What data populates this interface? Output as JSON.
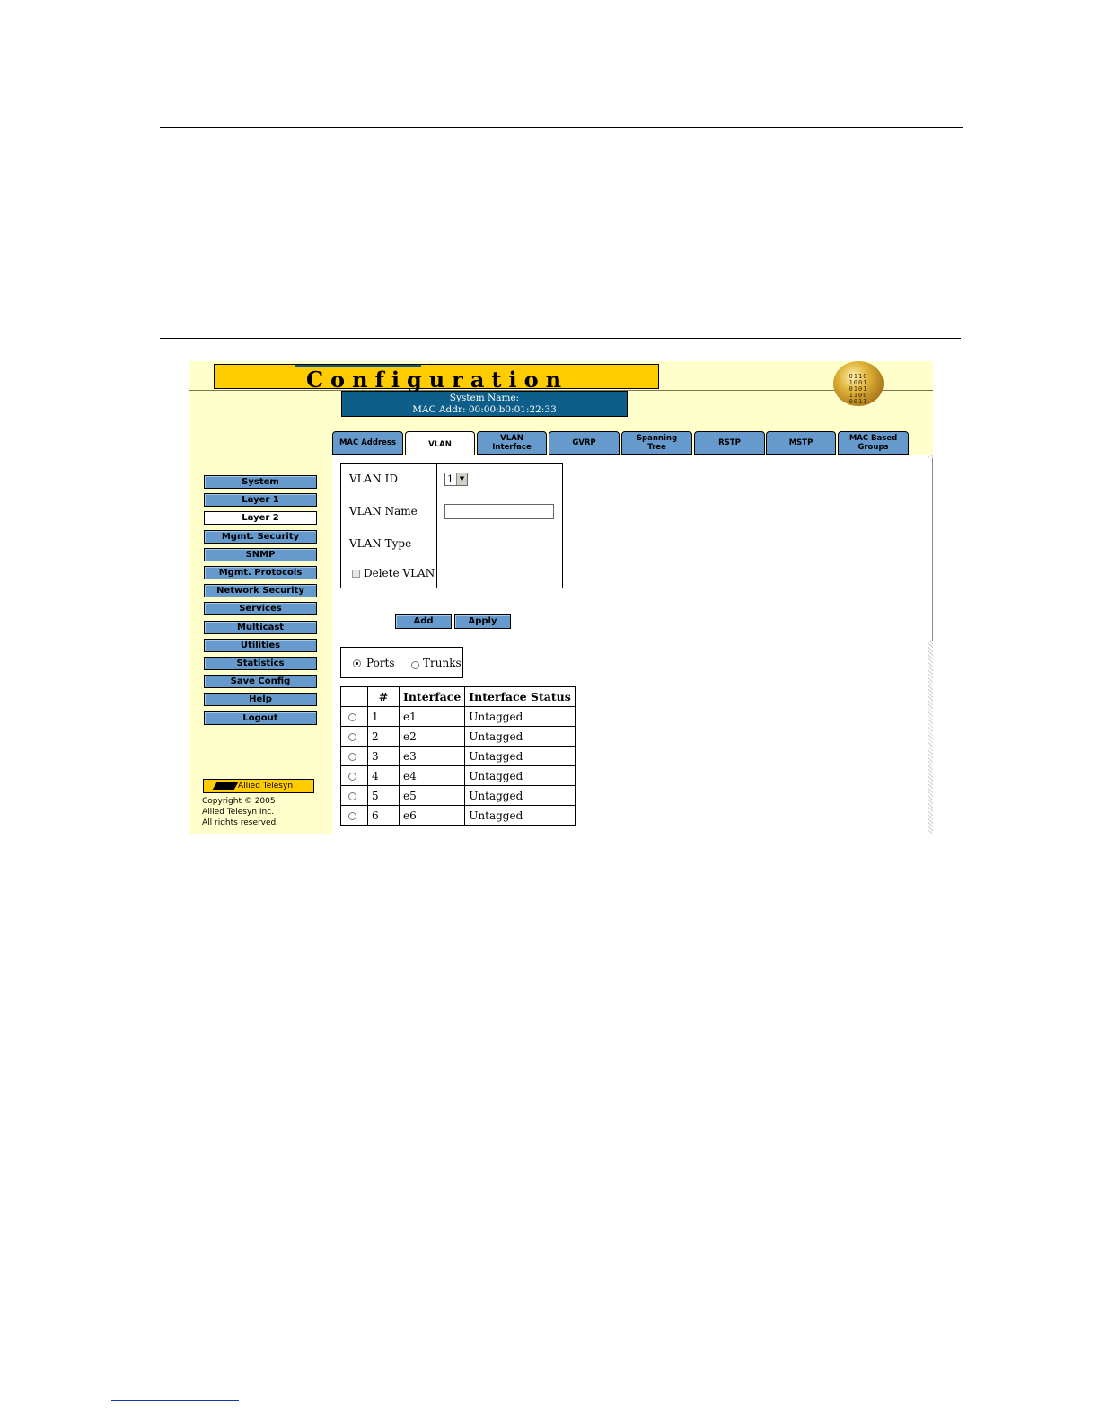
{
  "header": {
    "title": "Configuration",
    "system_name": "System Name:",
    "mac_addr": "MAC Addr: 00:00:b0:01:22:33",
    "globe_text": "0110 1001 0101 1100 0011"
  },
  "tabs": [
    {
      "label": "MAC Address",
      "active": false
    },
    {
      "label": "VLAN",
      "active": true
    },
    {
      "label": "VLAN Interface",
      "active": false
    },
    {
      "label": "GVRP",
      "active": false
    },
    {
      "label": "Spanning Tree",
      "active": false
    },
    {
      "label": "RSTP",
      "active": false
    },
    {
      "label": "MSTP",
      "active": false
    },
    {
      "label": "MAC Based Groups",
      "active": false
    }
  ],
  "sidebar": {
    "items": [
      {
        "label": "System",
        "active": false
      },
      {
        "label": "Layer 1",
        "active": false
      },
      {
        "label": "Layer 2",
        "active": true
      },
      {
        "label": "Mgmt. Security",
        "active": false
      },
      {
        "label": "SNMP",
        "active": false
      },
      {
        "label": "Mgmt. Protocols",
        "active": false
      },
      {
        "label": "Network Security",
        "active": false
      },
      {
        "label": "Services",
        "active": false
      },
      {
        "label": "Multicast",
        "active": false
      },
      {
        "label": "Utilities",
        "active": false
      },
      {
        "label": "Statistics",
        "active": false
      },
      {
        "label": "Save Config",
        "active": false
      },
      {
        "label": "Help",
        "active": false
      },
      {
        "label": "Logout",
        "active": false
      }
    ],
    "logo": "Allied Telesyn",
    "copyright": [
      "Copyright © 2005",
      "Allied Telesyn Inc.",
      "All rights reserved."
    ]
  },
  "form": {
    "vlan_id_label": "VLAN ID",
    "vlan_id_value": "1",
    "vlan_name_label": "VLAN Name",
    "vlan_name_value": "",
    "vlan_type_label": "VLAN Type",
    "delete_vlan_label": "Delete VLAN",
    "delete_vlan_checked": false,
    "add_label": "Add",
    "apply_label": "Apply"
  },
  "filter": {
    "ports_label": "Ports",
    "trunks_label": "Trunks",
    "selected": "Ports"
  },
  "table": {
    "headers": [
      "",
      "#",
      "Interface",
      "Interface Status"
    ],
    "rows": [
      {
        "num": "1",
        "iface": "e1",
        "status": "Untagged"
      },
      {
        "num": "2",
        "iface": "e2",
        "status": "Untagged"
      },
      {
        "num": "3",
        "iface": "e3",
        "status": "Untagged"
      },
      {
        "num": "4",
        "iface": "e4",
        "status": "Untagged"
      },
      {
        "num": "5",
        "iface": "e5",
        "status": "Untagged"
      },
      {
        "num": "6",
        "iface": "e6",
        "status": "Untagged"
      }
    ]
  },
  "colors": {
    "panel_bg": "#ffffcc",
    "title_yellow": "#ffcc00",
    "header_blue": "#0d5f8a",
    "button_blue": "#6699cc"
  }
}
